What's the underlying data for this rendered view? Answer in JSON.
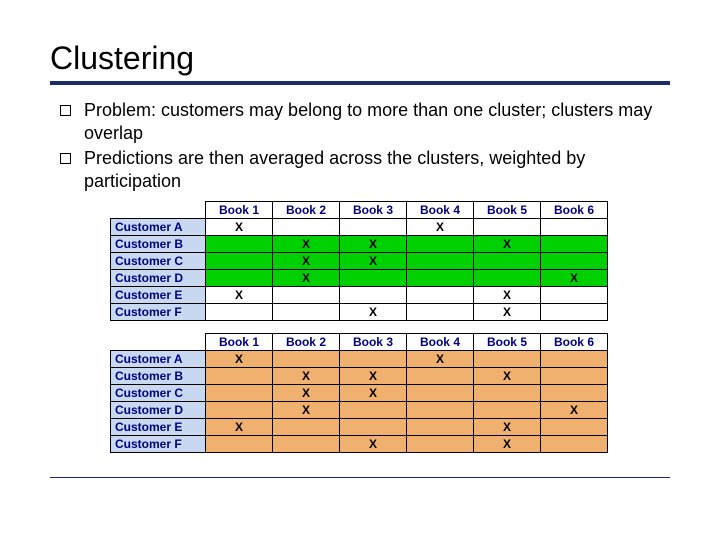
{
  "title": "Clustering",
  "bullets": {
    "b1": "Problem: customers may belong to more than one cluster; clusters may overlap",
    "b2": "Predictions are then averaged across the clusters, weighted by participation"
  },
  "columns": [
    "Book 1",
    "Book 2",
    "Book 3",
    "Book 4",
    "Book 5",
    "Book 6"
  ],
  "customers": [
    "Customer A",
    "Customer B",
    "Customer C",
    "Customer D",
    "Customer E",
    "Customer F"
  ],
  "marks": {
    "A": [
      "X",
      "",
      "",
      "X",
      "",
      ""
    ],
    "B": [
      "",
      "X",
      "X",
      "",
      "X",
      ""
    ],
    "C": [
      "",
      "X",
      "X",
      "",
      "",
      ""
    ],
    "D": [
      "",
      "X",
      "",
      "",
      "",
      "X"
    ],
    "E": [
      "X",
      "",
      "",
      "",
      "X",
      ""
    ],
    "F": [
      "",
      "",
      "X",
      "",
      "X",
      ""
    ]
  },
  "table1_row_colors": [
    "white",
    "green",
    "green",
    "green",
    "white",
    "white"
  ],
  "table2_row_colors": [
    "orange",
    "orange",
    "orange",
    "orange",
    "orange",
    "orange"
  ]
}
